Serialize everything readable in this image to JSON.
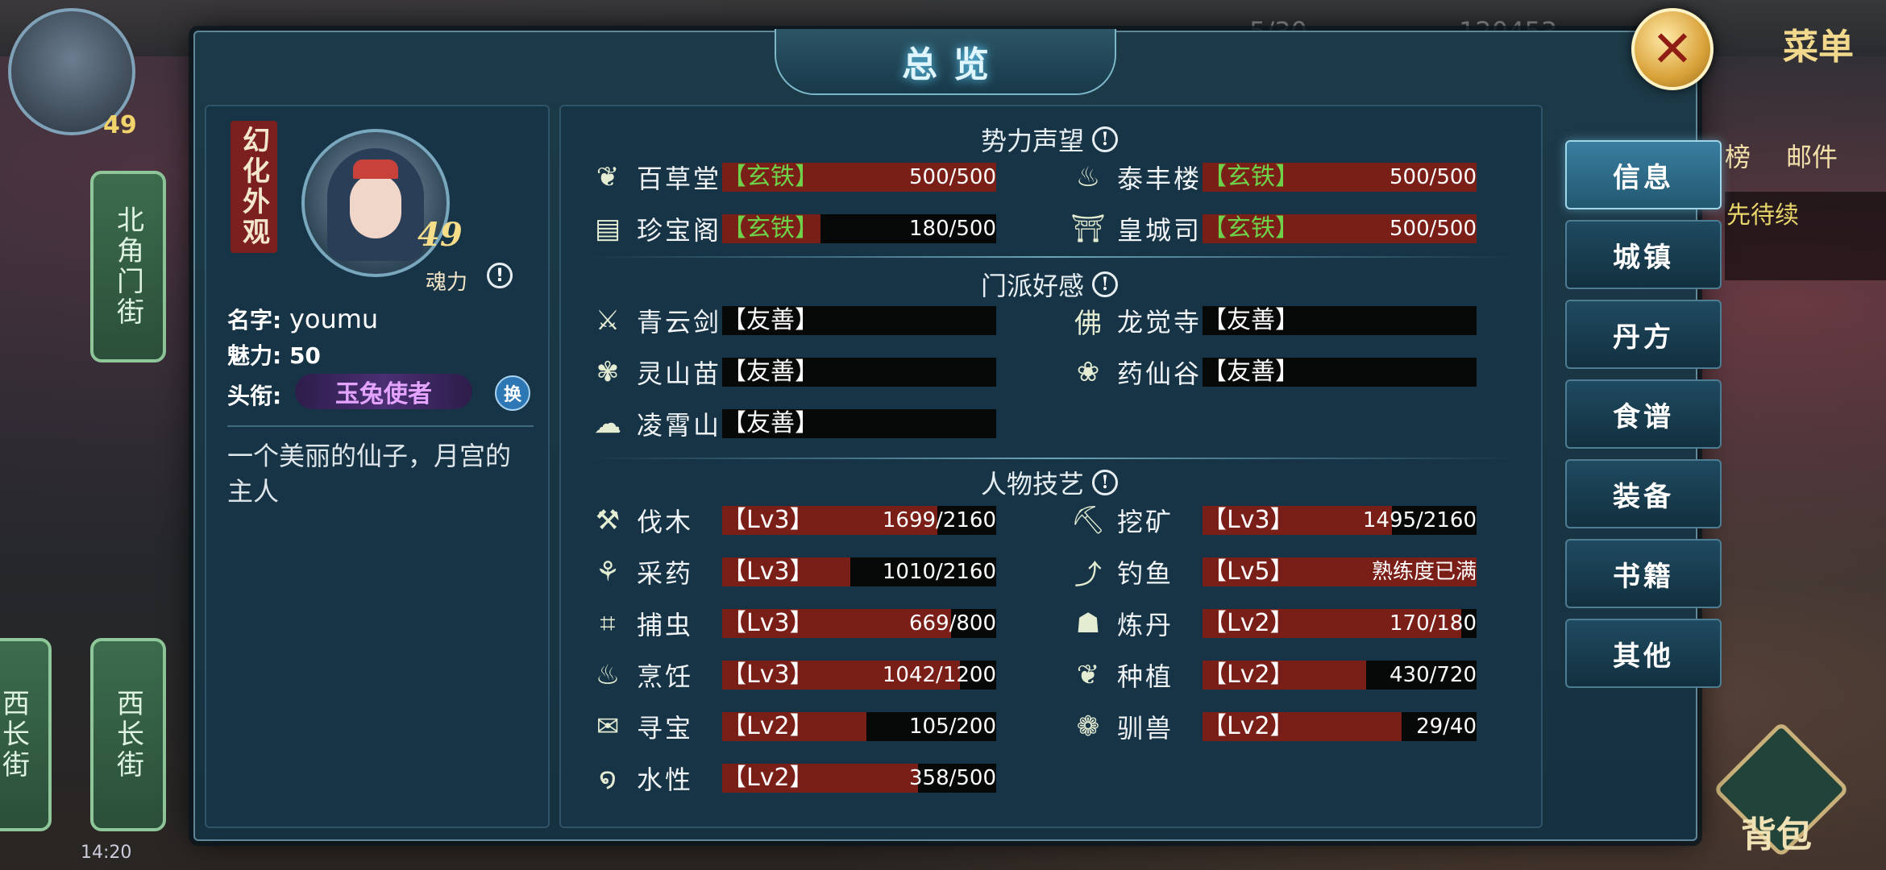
{
  "hud": {
    "menu": "菜单",
    "mail": "邮件",
    "rank": "榜",
    "level": "49",
    "quest": "先待续",
    "bag": "背包",
    "time": "14:20",
    "streets": [
      "北角门街",
      "西长街",
      "西长街"
    ],
    "top_stats": [
      "5/30",
      "120453",
      "49"
    ]
  },
  "dialog": {
    "title": "总览",
    "close": "✕"
  },
  "profile": {
    "appearance": "幻化外观",
    "level": "49",
    "soul_label": "魂力",
    "info_icon": "!",
    "name_label": "名字:",
    "name_value": "youmu",
    "charm_label": "魅力:",
    "charm_value": "50",
    "title_label": "头衔:",
    "title_value": "玉兔使者",
    "swap_label": "换",
    "description": "一个美丽的仙子，月宫的主人"
  },
  "sections": {
    "reputation": "势力声望",
    "sect": "门派好感",
    "skills": "人物技艺"
  },
  "reputation": [
    {
      "name": "百草堂",
      "tag": "【玄铁】",
      "value": "500/500",
      "fill": 1.0,
      "icon": "leaf-icon",
      "glyph": "❦"
    },
    {
      "name": "泰丰楼",
      "tag": "【玄铁】",
      "value": "500/500",
      "fill": 1.0,
      "icon": "pot-icon",
      "glyph": "♨"
    },
    {
      "name": "珍宝阁",
      "tag": "【玄铁】",
      "value": "180/500",
      "fill": 0.36,
      "icon": "chest-icon",
      "glyph": "▤"
    },
    {
      "name": "皇城司",
      "tag": "【玄铁】",
      "value": "500/500",
      "fill": 1.0,
      "icon": "gate-icon",
      "glyph": "⛩"
    }
  ],
  "sects": [
    {
      "name": "青云剑宗",
      "tag": "【友善】",
      "icon": "sword-icon",
      "glyph": "⚔"
    },
    {
      "name": "龙觉寺",
      "tag": "【友善】",
      "icon": "buddha-icon",
      "glyph": "佛"
    },
    {
      "name": "灵山苗疆",
      "tag": "【友善】",
      "icon": "butterfly-icon",
      "glyph": "✾"
    },
    {
      "name": "药仙谷",
      "tag": "【友善】",
      "icon": "lotus-icon",
      "glyph": "❀"
    },
    {
      "name": "凌霄山",
      "tag": "【友善】",
      "icon": "cloud-icon",
      "glyph": "☁"
    }
  ],
  "skills": [
    {
      "name": "伐木",
      "tag": "【Lv3】",
      "value": "1699/2160",
      "fill": 0.786,
      "icon": "axe-icon",
      "glyph": "⚒"
    },
    {
      "name": "挖矿",
      "tag": "【Lv3】",
      "value": "1495/2160",
      "fill": 0.692,
      "icon": "pickaxe-icon",
      "glyph": "⛏"
    },
    {
      "name": "采药",
      "tag": "【Lv3】",
      "value": "1010/2160",
      "fill": 0.468,
      "icon": "herb-icon",
      "glyph": "⚘"
    },
    {
      "name": "钓鱼",
      "tag": "【Lv5】",
      "value": "熟练度已满",
      "fill": 1.0,
      "icon": "fishing-icon",
      "glyph": "⤴"
    },
    {
      "name": "捕虫",
      "tag": "【Lv3】",
      "value": "669/800",
      "fill": 0.836,
      "icon": "net-icon",
      "glyph": "⌗"
    },
    {
      "name": "炼丹",
      "tag": "【Lv2】",
      "value": "170/180",
      "fill": 0.944,
      "icon": "cauldron-icon",
      "glyph": "☗"
    },
    {
      "name": "烹饪",
      "tag": "【Lv3】",
      "value": "1042/1200",
      "fill": 0.868,
      "icon": "cooking-icon",
      "glyph": "♨"
    },
    {
      "name": "种植",
      "tag": "【Lv2】",
      "value": "430/720",
      "fill": 0.597,
      "icon": "sprout-icon",
      "glyph": "❦"
    },
    {
      "name": "寻宝",
      "tag": "【Lv2】",
      "value": "105/200",
      "fill": 0.525,
      "icon": "scroll-icon",
      "glyph": "✉"
    },
    {
      "name": "驯兽",
      "tag": "【Lv2】",
      "value": "29/40",
      "fill": 0.725,
      "icon": "paw-icon",
      "glyph": "❁"
    },
    {
      "name": "水性",
      "tag": "【Lv2】",
      "value": "358/500",
      "fill": 0.716,
      "icon": "wave-icon",
      "glyph": "໑"
    }
  ],
  "tabs": [
    "信息",
    "城镇",
    "丹方",
    "食谱",
    "装备",
    "书籍",
    "其他"
  ],
  "colors": {
    "bar_fill": "#7a1f17",
    "bar_bg": "#070909",
    "tag_green": "#6dd24a",
    "panel": "#173446"
  }
}
